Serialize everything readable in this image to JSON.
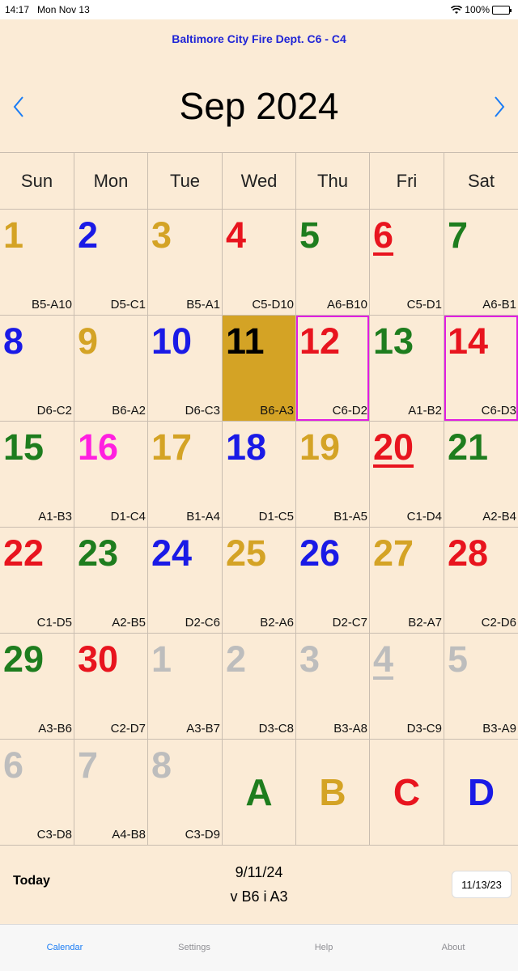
{
  "status": {
    "time": "14:17",
    "date": "Mon Nov 13",
    "battery": "100%"
  },
  "header": {
    "department": "Baltimore City Fire Dept.    C6 - C4",
    "month": "Sep 2024"
  },
  "days_of_week": [
    "Sun",
    "Mon",
    "Tue",
    "Wed",
    "Thu",
    "Fri",
    "Sat"
  ],
  "colors": {
    "gold": "#d4a325",
    "blue": "#1a1ae6",
    "red": "#e8141e",
    "green": "#1e7d1e",
    "magenta": "#ff1fe0",
    "gray": "#bdbdbd"
  },
  "weeks": [
    [
      {
        "day": "1",
        "rot": "B5-A10",
        "color": "gold"
      },
      {
        "day": "2",
        "rot": "D5-C1",
        "color": "blue"
      },
      {
        "day": "3",
        "rot": "B5-A1",
        "color": "gold"
      },
      {
        "day": "4",
        "rot": "C5-D10",
        "color": "red"
      },
      {
        "day": "5",
        "rot": "A6-B10",
        "color": "green"
      },
      {
        "day": "6",
        "rot": "C5-D1",
        "color": "red",
        "underline": true
      },
      {
        "day": "7",
        "rot": "A6-B1",
        "color": "green"
      }
    ],
    [
      {
        "day": "8",
        "rot": "D6-C2",
        "color": "blue"
      },
      {
        "day": "9",
        "rot": "B6-A2",
        "color": "gold"
      },
      {
        "day": "10",
        "rot": "D6-C3",
        "color": "blue"
      },
      {
        "day": "11",
        "rot": "B6-A3",
        "color": "black",
        "selected": true
      },
      {
        "day": "12",
        "rot": "C6-D2",
        "color": "red",
        "boxed": true
      },
      {
        "day": "13",
        "rot": "A1-B2",
        "color": "green"
      },
      {
        "day": "14",
        "rot": "C6-D3",
        "color": "red",
        "boxed": true
      }
    ],
    [
      {
        "day": "15",
        "rot": "A1-B3",
        "color": "green"
      },
      {
        "day": "16",
        "rot": "D1-C4",
        "color": "magenta"
      },
      {
        "day": "17",
        "rot": "B1-A4",
        "color": "gold"
      },
      {
        "day": "18",
        "rot": "D1-C5",
        "color": "blue"
      },
      {
        "day": "19",
        "rot": "B1-A5",
        "color": "gold"
      },
      {
        "day": "20",
        "rot": "C1-D4",
        "color": "red",
        "underline": true
      },
      {
        "day": "21",
        "rot": "A2-B4",
        "color": "green"
      }
    ],
    [
      {
        "day": "22",
        "rot": "C1-D5",
        "color": "red"
      },
      {
        "day": "23",
        "rot": "A2-B5",
        "color": "green"
      },
      {
        "day": "24",
        "rot": "D2-C6",
        "color": "blue"
      },
      {
        "day": "25",
        "rot": "B2-A6",
        "color": "gold"
      },
      {
        "day": "26",
        "rot": "D2-C7",
        "color": "blue"
      },
      {
        "day": "27",
        "rot": "B2-A7",
        "color": "gold"
      },
      {
        "day": "28",
        "rot": "C2-D6",
        "color": "red"
      }
    ],
    [
      {
        "day": "29",
        "rot": "A3-B6",
        "color": "green"
      },
      {
        "day": "30",
        "rot": "C2-D7",
        "color": "red"
      },
      {
        "day": "1",
        "rot": "A3-B7",
        "color": "gray"
      },
      {
        "day": "2",
        "rot": "D3-C8",
        "color": "gray"
      },
      {
        "day": "3",
        "rot": "B3-A8",
        "color": "gray"
      },
      {
        "day": "4",
        "rot": "D3-C9",
        "color": "gray",
        "underline": true
      },
      {
        "day": "5",
        "rot": "B3-A9",
        "color": "gray"
      }
    ],
    [
      {
        "day": "6",
        "rot": "C3-D8",
        "color": "gray"
      },
      {
        "day": "7",
        "rot": "A4-B8",
        "color": "gray"
      },
      {
        "day": "8",
        "rot": "C3-D9",
        "color": "gray"
      },
      {
        "letter": "A",
        "color": "green"
      },
      {
        "letter": "B",
        "color": "gold"
      },
      {
        "letter": "C",
        "color": "red"
      },
      {
        "letter": "D",
        "color": "blue"
      }
    ]
  ],
  "today": {
    "label": "Today",
    "date": "9/11/24",
    "shift": "v B6    i A3",
    "button": "11/13/23"
  },
  "tabs": [
    {
      "label": "Calendar",
      "active": true
    },
    {
      "label": "Settings"
    },
    {
      "label": "Help"
    },
    {
      "label": "About"
    }
  ]
}
